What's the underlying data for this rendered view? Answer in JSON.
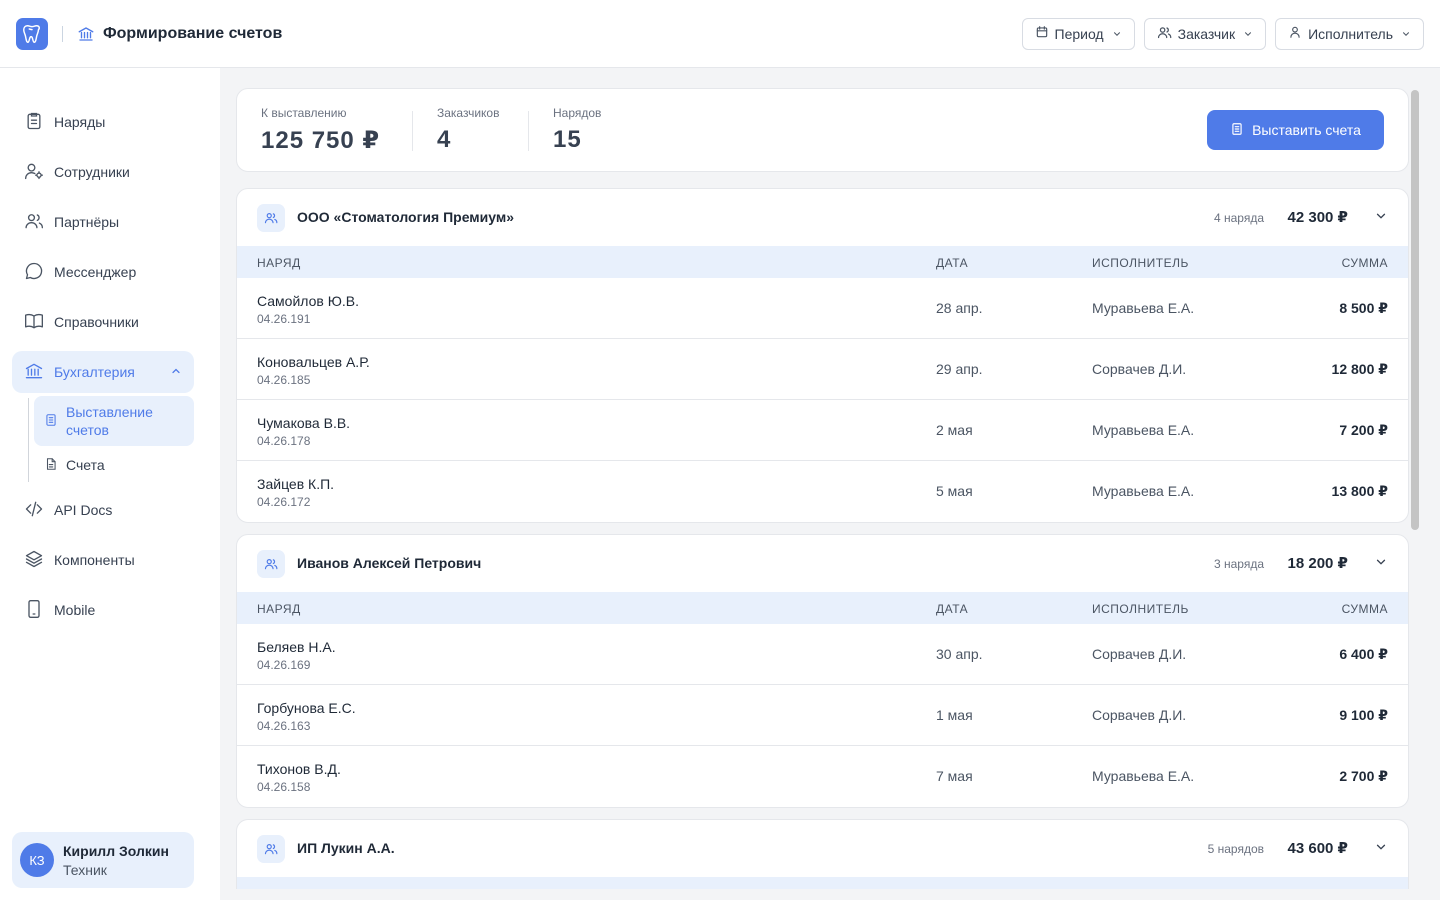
{
  "header": {
    "title": "Формирование счетов",
    "filters": [
      {
        "label": "Период",
        "icon": "calendar-icon"
      },
      {
        "label": "Заказчик",
        "icon": "users-icon"
      },
      {
        "label": "Исполнитель",
        "icon": "user-icon"
      }
    ]
  },
  "sidebar": {
    "items": [
      {
        "label": "Наряды",
        "icon": "clipboard-icon"
      },
      {
        "label": "Сотрудники",
        "icon": "user-gear-icon"
      },
      {
        "label": "Партнёры",
        "icon": "users-icon"
      },
      {
        "label": "Мессенджер",
        "icon": "chat-icon"
      },
      {
        "label": "Справочники",
        "icon": "book-icon"
      },
      {
        "label": "Бухгалтерия",
        "icon": "bank-icon"
      },
      {
        "label": "API Docs",
        "icon": "code-icon"
      },
      {
        "label": "Компоненты",
        "icon": "layers-icon"
      },
      {
        "label": "Mobile",
        "icon": "phone-icon"
      }
    ],
    "sub_items": [
      {
        "label": "Выставление счетов",
        "icon": "document-icon"
      },
      {
        "label": "Счета",
        "icon": "file-icon"
      }
    ],
    "user": {
      "initials": "КЗ",
      "name": "Кирилл Золкин",
      "role": "Техник"
    }
  },
  "summary": {
    "stats": [
      {
        "label": "К выставлению",
        "value": "125 750 ₽"
      },
      {
        "label": "Заказчиков",
        "value": "4"
      },
      {
        "label": "Нарядов",
        "value": "15"
      }
    ],
    "button_label": "Выставить счета"
  },
  "table_headers": {
    "order": "НАРЯД",
    "date": "ДАТА",
    "executor": "ИСПОЛНИТЕЛЬ",
    "sum": "СУММА"
  },
  "customers": [
    {
      "name": "ООО «Стоматология Премиум»",
      "count": "4 наряда",
      "total": "42 300 ₽",
      "rows": [
        {
          "name": "Самойлов Ю.В.",
          "code": "04.26.191",
          "date": "28 апр.",
          "executor": "Муравьева Е.А.",
          "sum": "8 500 ₽"
        },
        {
          "name": "Коновальцев А.Р.",
          "code": "04.26.185",
          "date": "29 апр.",
          "executor": "Сорвачев Д.И.",
          "sum": "12 800 ₽"
        },
        {
          "name": "Чумакова В.В.",
          "code": "04.26.178",
          "date": "2 мая",
          "executor": "Муравьева Е.А.",
          "sum": "7 200 ₽"
        },
        {
          "name": "Зайцев К.П.",
          "code": "04.26.172",
          "date": "5 мая",
          "executor": "Муравьева Е.А.",
          "sum": "13 800 ₽"
        }
      ]
    },
    {
      "name": "Иванов Алексей Петрович",
      "count": "3 наряда",
      "total": "18 200 ₽",
      "rows": [
        {
          "name": "Беляев Н.А.",
          "code": "04.26.169",
          "date": "30 апр.",
          "executor": "Сорвачев Д.И.",
          "sum": "6 400 ₽"
        },
        {
          "name": "Горбунова Е.С.",
          "code": "04.26.163",
          "date": "1 мая",
          "executor": "Сорвачев Д.И.",
          "sum": "9 100 ₽"
        },
        {
          "name": "Тихонов В.Д.",
          "code": "04.26.158",
          "date": "7 мая",
          "executor": "Муравьева Е.А.",
          "sum": "2 700 ₽"
        }
      ]
    },
    {
      "name": "ИП Лукин А.А.",
      "count": "5 нарядов",
      "total": "43 600 ₽",
      "rows": []
    }
  ],
  "colors": {
    "accent": "#4f7be8",
    "accent_light": "#e8f0fc"
  }
}
